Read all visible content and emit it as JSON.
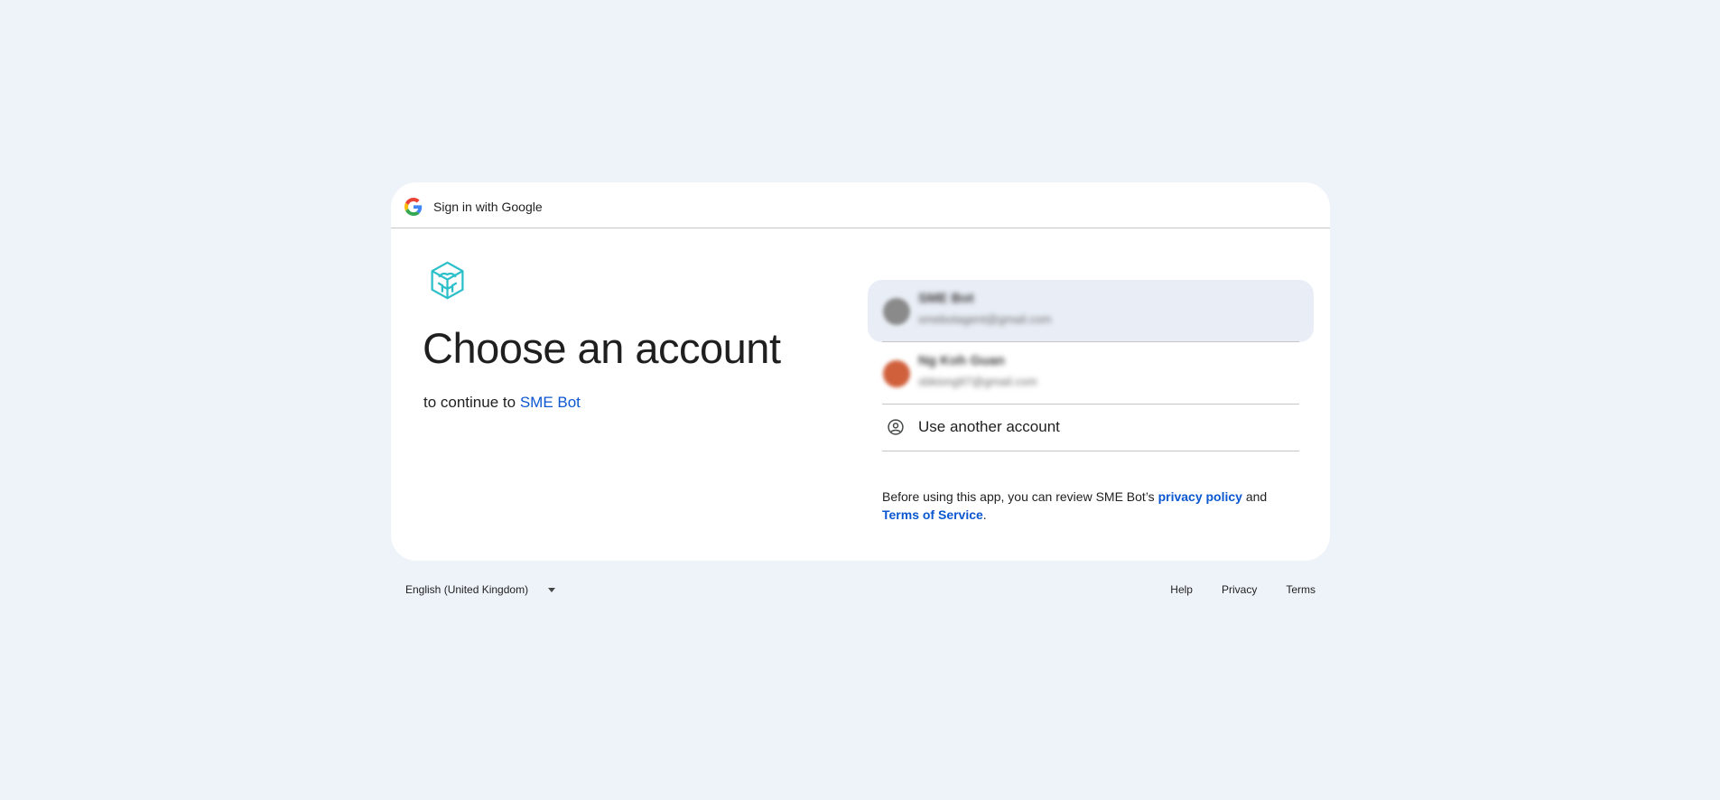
{
  "header": {
    "title": "Sign in with Google"
  },
  "main": {
    "title": "Choose an account",
    "subtitle_prefix": "to continue to",
    "app_name": "SME Bot"
  },
  "accounts": [
    {
      "name": "SME Bot",
      "email": "smebotagent@gmail.com",
      "avatar_color": "#8a8a8a"
    },
    {
      "name": "Ng Koh Guan",
      "email": "sbkiong97@gmail.com",
      "avatar_color": "#d0603c"
    }
  ],
  "use_another": {
    "label": "Use another account",
    "icon": "account-circle-icon"
  },
  "disclaimer": {
    "prefix": "Before using this app, you can review SME Bot’s",
    "privacy_link": "privacy policy",
    "middle": "and",
    "terms_link": "Terms of Service",
    "suffix": "."
  },
  "footer": {
    "language": "English (United Kingdom)",
    "links": [
      "Help",
      "Privacy",
      "Terms"
    ]
  },
  "colors": {
    "background": "#eef2f9",
    "link": "#0b57d0",
    "app_logo": "#2bbfc9"
  }
}
